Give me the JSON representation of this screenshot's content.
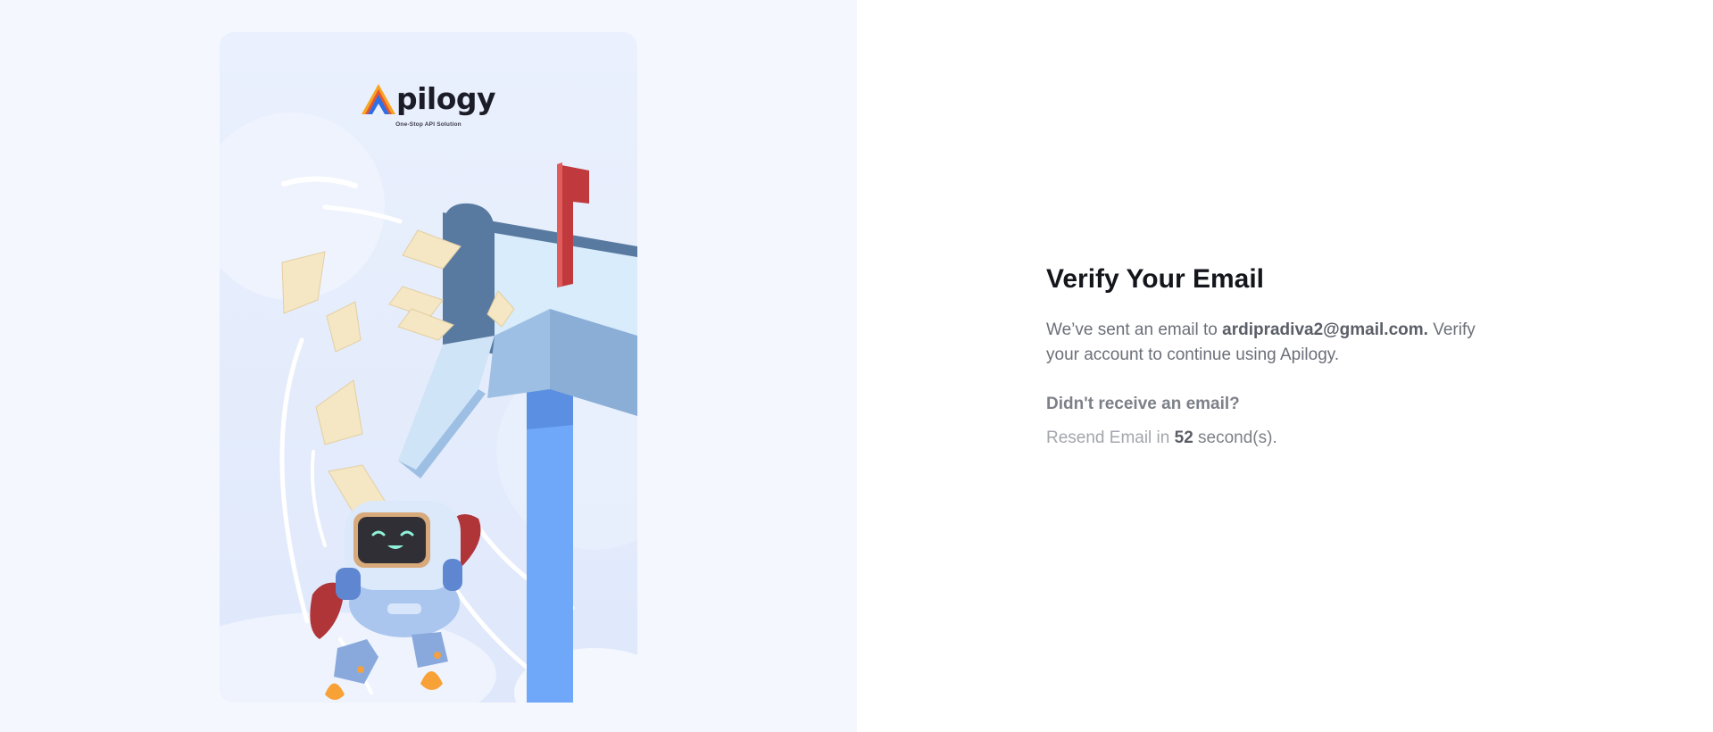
{
  "brand": {
    "name": "pilogy",
    "tagline": "One-Stop API Solution",
    "logo_colors": [
      "#f5a623",
      "#e8542f",
      "#2f6fe4"
    ]
  },
  "illustration": {
    "icon": "robot-with-mailbox-illustration",
    "colors": {
      "mailbox_dark": "#587aa0",
      "mailbox_light": "#d8ecfb",
      "mailbox_mid": "#8aaed6",
      "post": "#6ea5f7",
      "flag": "#c0393c",
      "envelope": "#f5e6c4"
    }
  },
  "verify": {
    "title": "Verify Your Email",
    "message_prefix": "We’ve sent an email to ",
    "email": "ardipradiva2@gmail.com.",
    "message_suffix": " Verify your account to continue using Apilogy.",
    "resend_question": "Didn't receive an email?",
    "resend_prefix": "Resend Email in ",
    "countdown": "52",
    "resend_suffix": " second(s)."
  }
}
